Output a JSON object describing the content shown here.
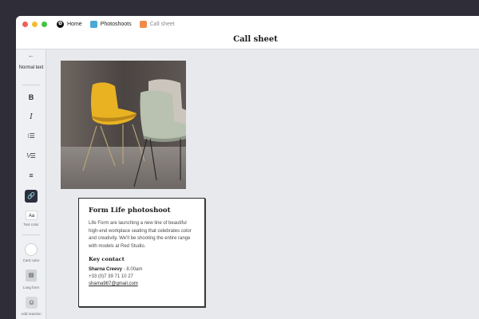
{
  "breadcrumb": {
    "home": "Home",
    "section": "Photoshoots",
    "current": "Call sheet",
    "section_color": "#4aa8d8",
    "current_color": "#f08a4b"
  },
  "header": {
    "title": "Call sheet"
  },
  "toolbar": {
    "back_icon": "arrow-left-icon",
    "text_style": "Normal text",
    "bold": "B",
    "italic": "I",
    "text_color_preview": "Aa",
    "text_color_label": "Text color",
    "card_color_label": "Card color",
    "long_form_label": "Long form",
    "add_reaction_label": "Add reaction"
  },
  "card": {
    "title": "Form Life photoshoot",
    "body": "Life Form are launching a new line of beautiful high-end workplace seating that celebrates color and creativity. We'll be shooting the entire range with models at Red Studio.",
    "key_contact_heading": "Key contact",
    "contact_name": "Sharna Creevy",
    "contact_time": " - 8.00am",
    "contact_phone": "+33 (0)7 39 71 10 27",
    "contact_email": "sharna987@gmail.com"
  },
  "colors": {
    "accent_dark": "#2b2f3a",
    "chair_yellow": "#e8b223",
    "chair_sage": "#b9c2b0"
  }
}
